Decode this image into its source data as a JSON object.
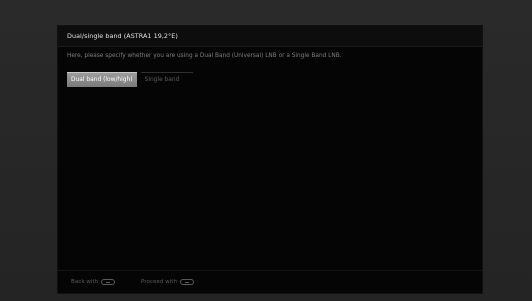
{
  "dialog": {
    "title": "Dual/single band (ASTRA1 19,2°E)",
    "description": "Here, please specify whether you are using a Dual Band (Universal) LNB or a Single Band LNB.",
    "options": [
      {
        "label": "Dual band (low/high)",
        "selected": true
      },
      {
        "label": "Single band",
        "selected": false
      }
    ]
  },
  "footer": {
    "back_label": "Back with",
    "back_key_icon": "back-key-icon",
    "proceed_label": "Proceed with",
    "proceed_key_icon": "ok-key-icon"
  },
  "colors": {
    "background": "#2b2b2b",
    "dialog": "#050505",
    "selected_option": "#8a8a8a"
  }
}
